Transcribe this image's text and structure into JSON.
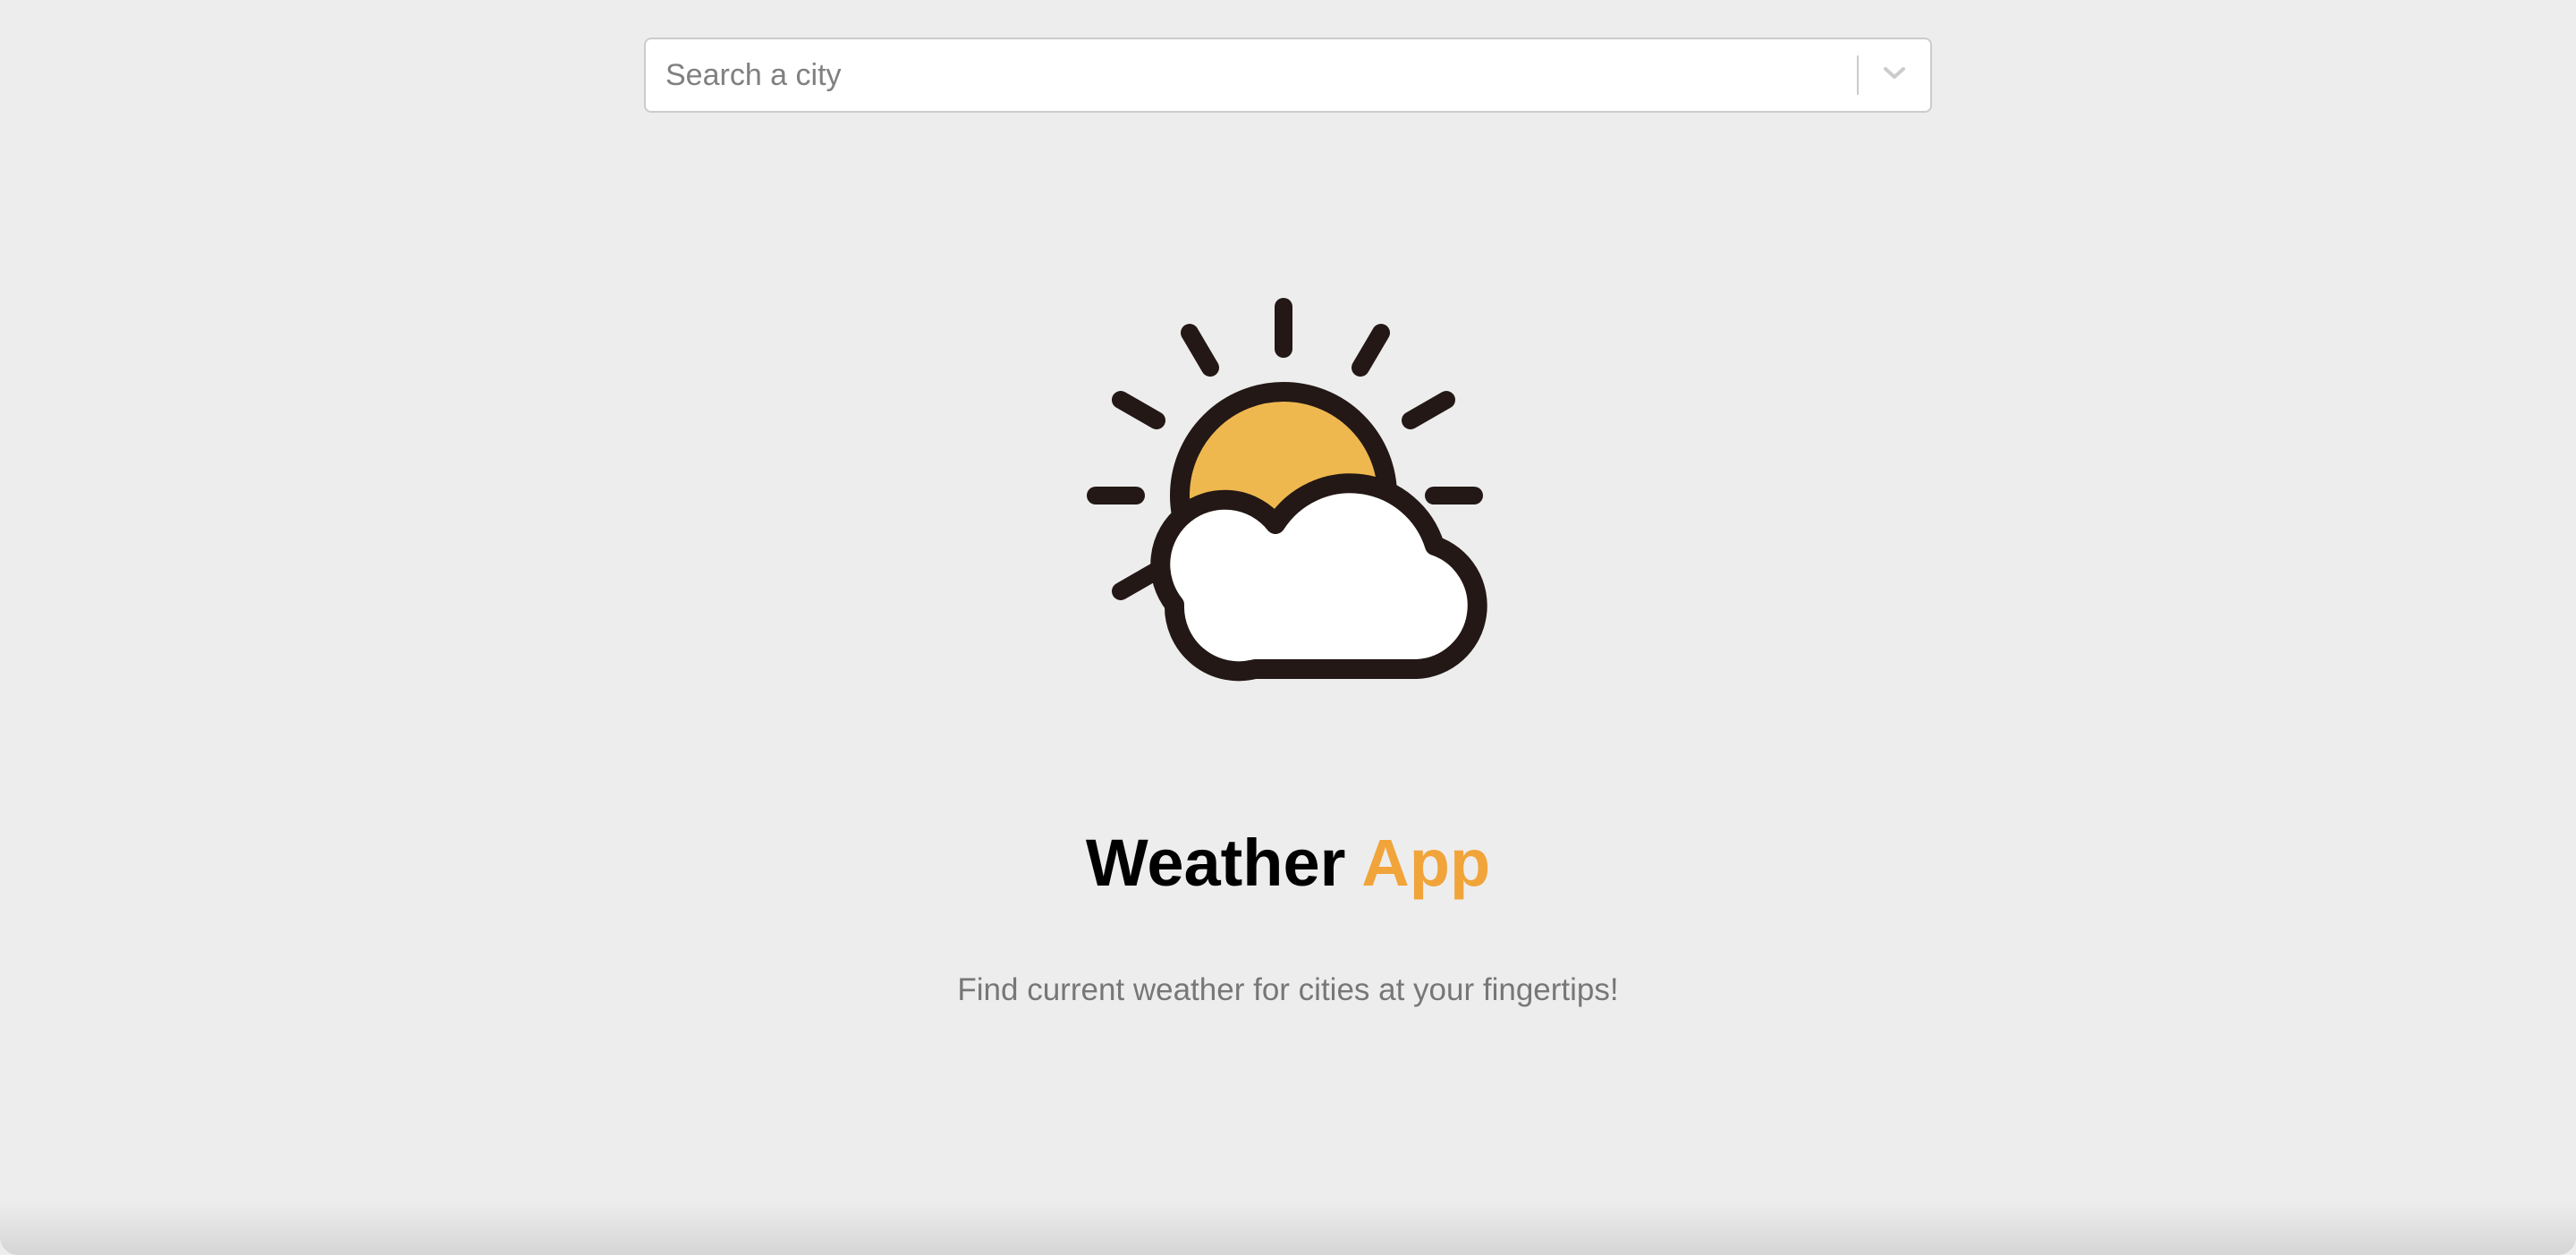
{
  "search": {
    "placeholder": "Search a city",
    "value": "",
    "toggle_icon": "chevron-down-icon"
  },
  "hero": {
    "icon": "sun-behind-cloud-icon",
    "colors": {
      "sun": "#efb84f",
      "outline": "#231815",
      "cloud": "#ffffff"
    }
  },
  "title": {
    "part1": "Weather",
    "part2": "App",
    "accent_color": "#f0a43a"
  },
  "subtitle": "Find current weather for cities at your fingertips!"
}
